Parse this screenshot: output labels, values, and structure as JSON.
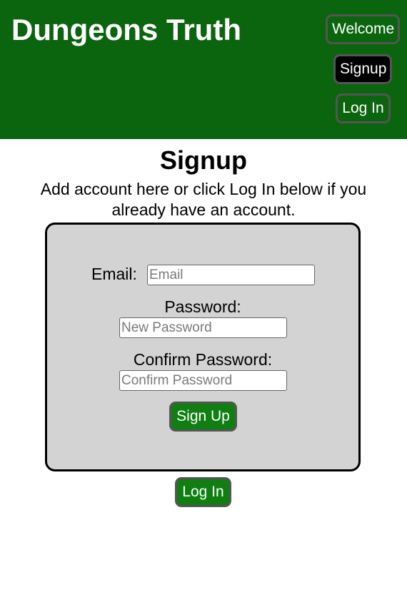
{
  "header": {
    "site_title": "Dungeons Truth",
    "nav": {
      "welcome": "Welcome",
      "signup": "Signup",
      "login": "Log In"
    }
  },
  "main": {
    "title": "Signup",
    "intro": "Add account here or click Log In below if you already have an account.",
    "form": {
      "email_label": "Email:",
      "email_placeholder": "Email",
      "password_label": "Password:",
      "password_placeholder": "New Password",
      "confirm_label": "Confirm Password:",
      "confirm_placeholder": "Confirm Password",
      "submit_label": "Sign Up"
    },
    "login_label": "Log In"
  },
  "colors": {
    "header_bg": "#0b640e",
    "button_bg": "#0f7f12",
    "active_nav_bg": "#000000",
    "form_bg": "#d3d3d3"
  }
}
